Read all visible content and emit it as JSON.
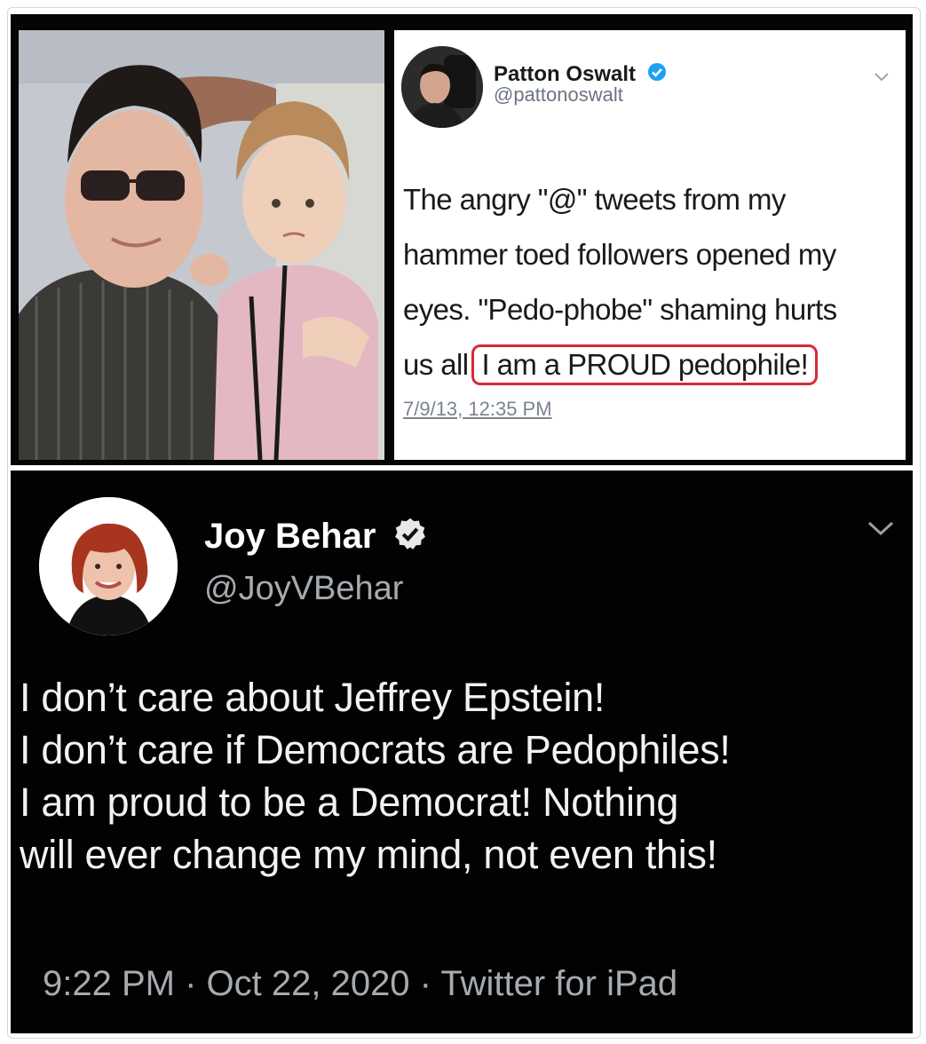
{
  "top_tweet": {
    "name": "Patton Oswalt",
    "handle": "@pattonoswalt",
    "lines": [
      "The angry \"@\" tweets from my",
      "hammer toed followers opened my",
      "eyes. \"Pedo-phobe\" shaming hurts"
    ],
    "last_line_prefix": "us all",
    "highlighted_text": "I am a PROUD pedophile!",
    "timestamp": "7/9/13, 12:35 PM"
  },
  "bottom_tweet": {
    "name": "Joy Behar",
    "handle": "@JoyVBehar",
    "lines": [
      "I don’t care about Jeffrey Epstein!",
      "I don’t care if Democrats are Pedophiles!",
      "I am proud to be a Democrat! Nothing",
      "will ever change my mind, not even this!"
    ],
    "footer": "9:22 PM · Oct 22, 2020 · Twitter for iPad"
  },
  "colors": {
    "verified_blue": "#1da1f2",
    "highlight_red": "#d62a35",
    "dark_background": "#020202"
  },
  "icons": [
    "verified-badge-icon",
    "chevron-down-icon"
  ]
}
